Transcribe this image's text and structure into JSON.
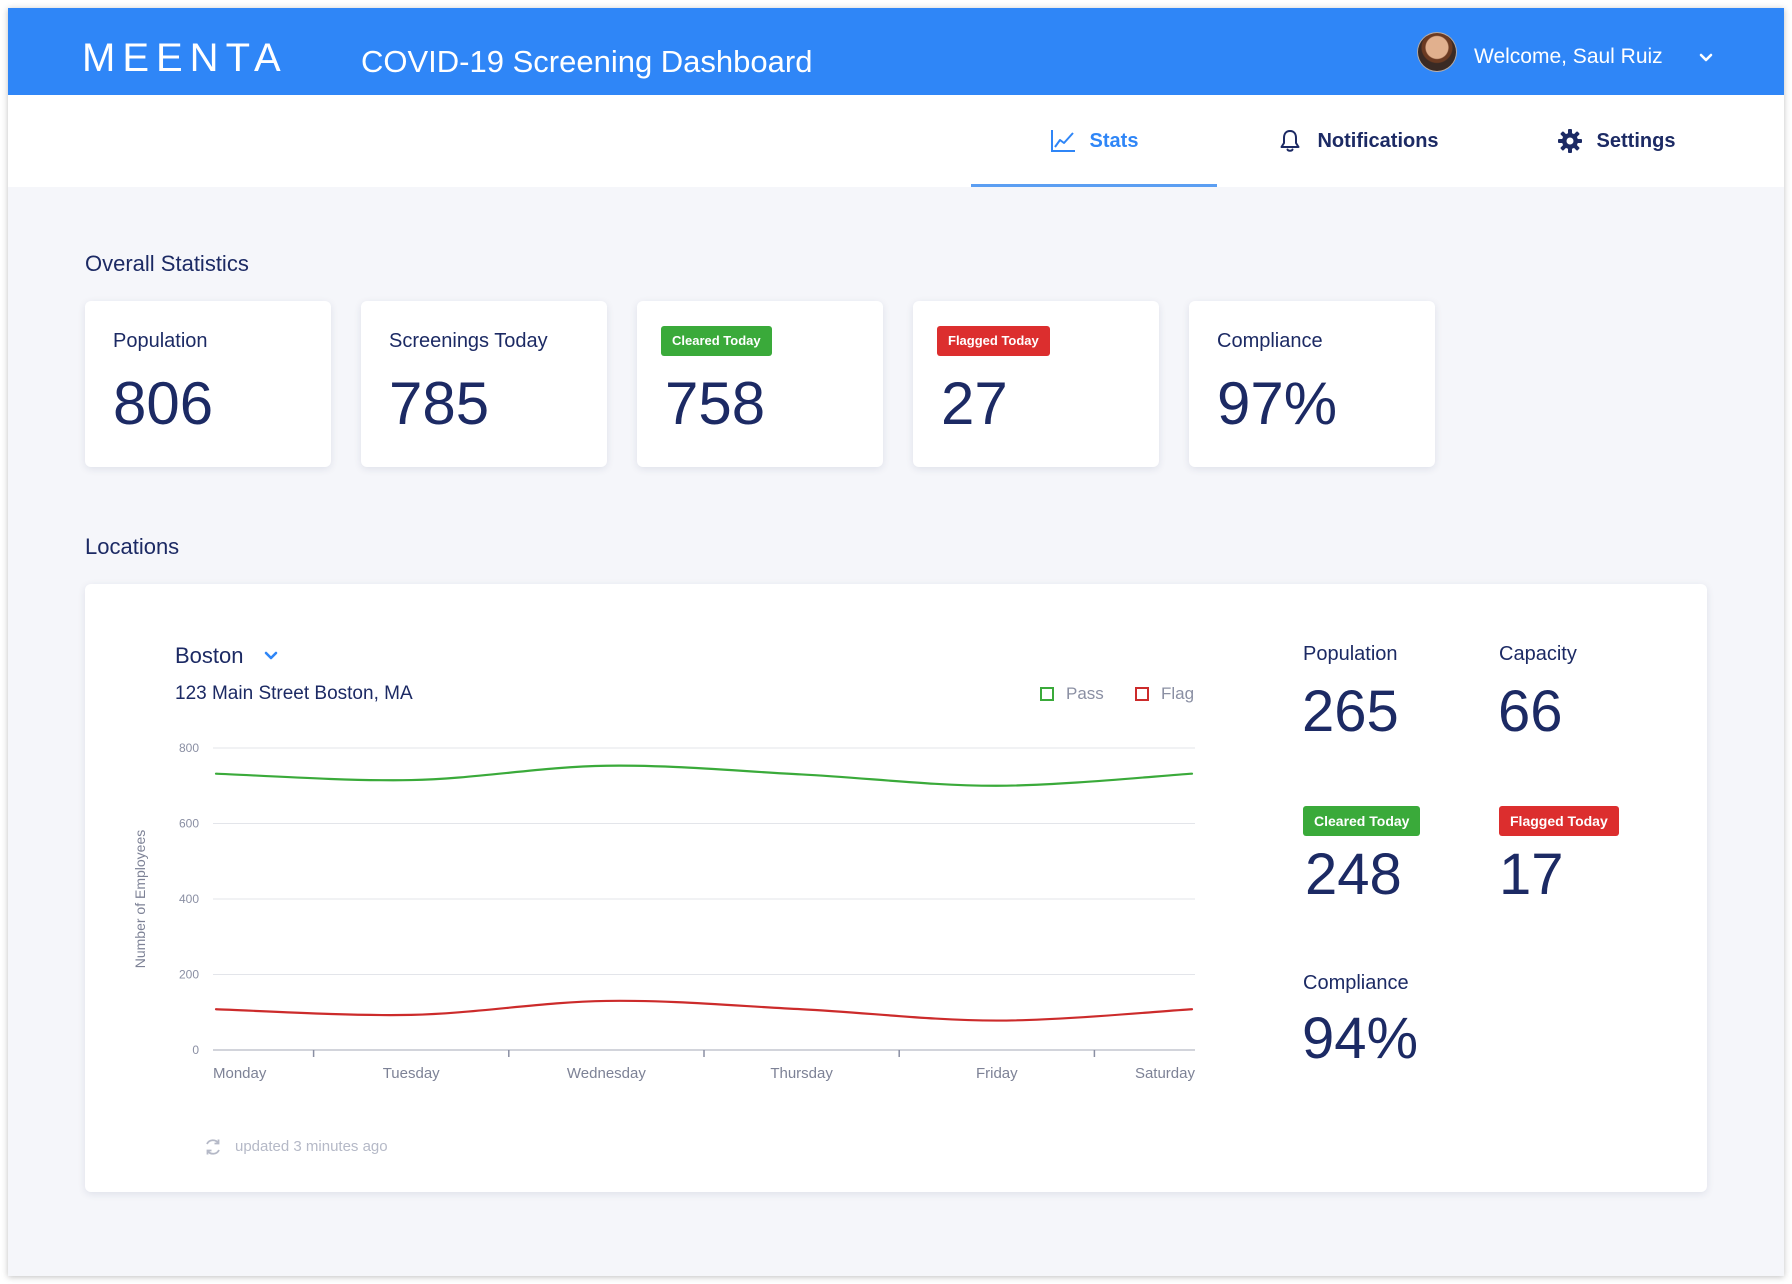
{
  "header": {
    "logo": "MEENTA",
    "title": "COVID-19 Screening Dashboard",
    "welcome": "Welcome, Saul Ruiz",
    "brand_color": "#2f86f7"
  },
  "tabs": [
    {
      "label": "Stats",
      "icon": "line-chart-icon",
      "active": true
    },
    {
      "label": "Notifications",
      "icon": "bell-icon",
      "active": false
    },
    {
      "label": "Settings",
      "icon": "gear-icon",
      "active": false
    }
  ],
  "overall": {
    "title": "Overall Statistics",
    "cards": [
      {
        "label": "Population",
        "value": "806"
      },
      {
        "label": "Screenings Today",
        "value": "785"
      },
      {
        "label": "Cleared Today",
        "value": "758",
        "badge": "green"
      },
      {
        "label": "Flagged Today",
        "value": "27",
        "badge": "red"
      },
      {
        "label": "Compliance",
        "value": "97%"
      }
    ]
  },
  "locations": {
    "title": "Locations",
    "selected": "Boston",
    "address": "123 Main Street Boston, MA",
    "updated": "updated 3 minutes ago",
    "stats": {
      "population_label": "Population",
      "population": "265",
      "capacity_label": "Capacity",
      "capacity": "66",
      "cleared_label": "Cleared Today",
      "cleared": "248",
      "flagged_label": "Flagged Today",
      "flagged": "17",
      "compliance_label": "Compliance",
      "compliance": "94%"
    }
  },
  "chart_data": {
    "type": "line",
    "title": "",
    "xlabel": "",
    "ylabel": "Number of Employees",
    "x": [
      "Monday",
      "Tuesday",
      "Wednesday",
      "Thursday",
      "Friday",
      "Saturday"
    ],
    "ylim": [
      0,
      800
    ],
    "yticks": [
      0,
      200,
      400,
      600,
      800
    ],
    "grid": true,
    "legend_position": "top-right",
    "series": [
      {
        "name": "Pass",
        "color": "#3aaa3a",
        "values": [
          732,
          715,
          753,
          730,
          700,
          732
        ]
      },
      {
        "name": "Flag",
        "color": "#cc2b2b",
        "values": [
          108,
          93,
          130,
          108,
          78,
          108
        ]
      }
    ]
  }
}
